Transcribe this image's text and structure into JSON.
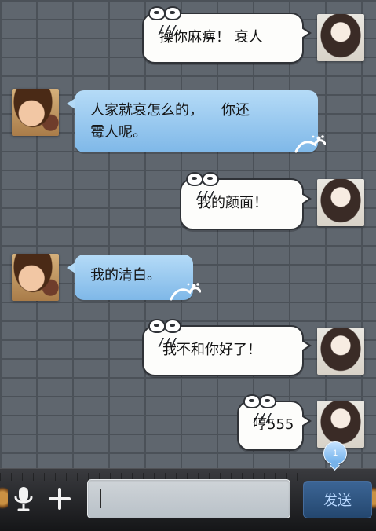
{
  "chat": {
    "messages": [
      {
        "side": "right",
        "text": "操你麻痹！ 衰人"
      },
      {
        "side": "left",
        "text": "人家就衰怎么的，    你还\n霉人呢。"
      },
      {
        "side": "right",
        "text": "我的颜面！"
      },
      {
        "side": "left",
        "text": "我的清白。"
      },
      {
        "side": "right",
        "text": "我不和你好了！"
      },
      {
        "side": "right",
        "text": "哼555"
      }
    ],
    "unread_badge": "1"
  },
  "input_bar": {
    "send_label": "发送",
    "input_value": "",
    "input_placeholder": ""
  },
  "colors": {
    "brick_bg": "#5f666e",
    "left_bubble": "#8ec4ef",
    "right_bubble": "#fdfdfb",
    "send_button": "#2f5888"
  }
}
